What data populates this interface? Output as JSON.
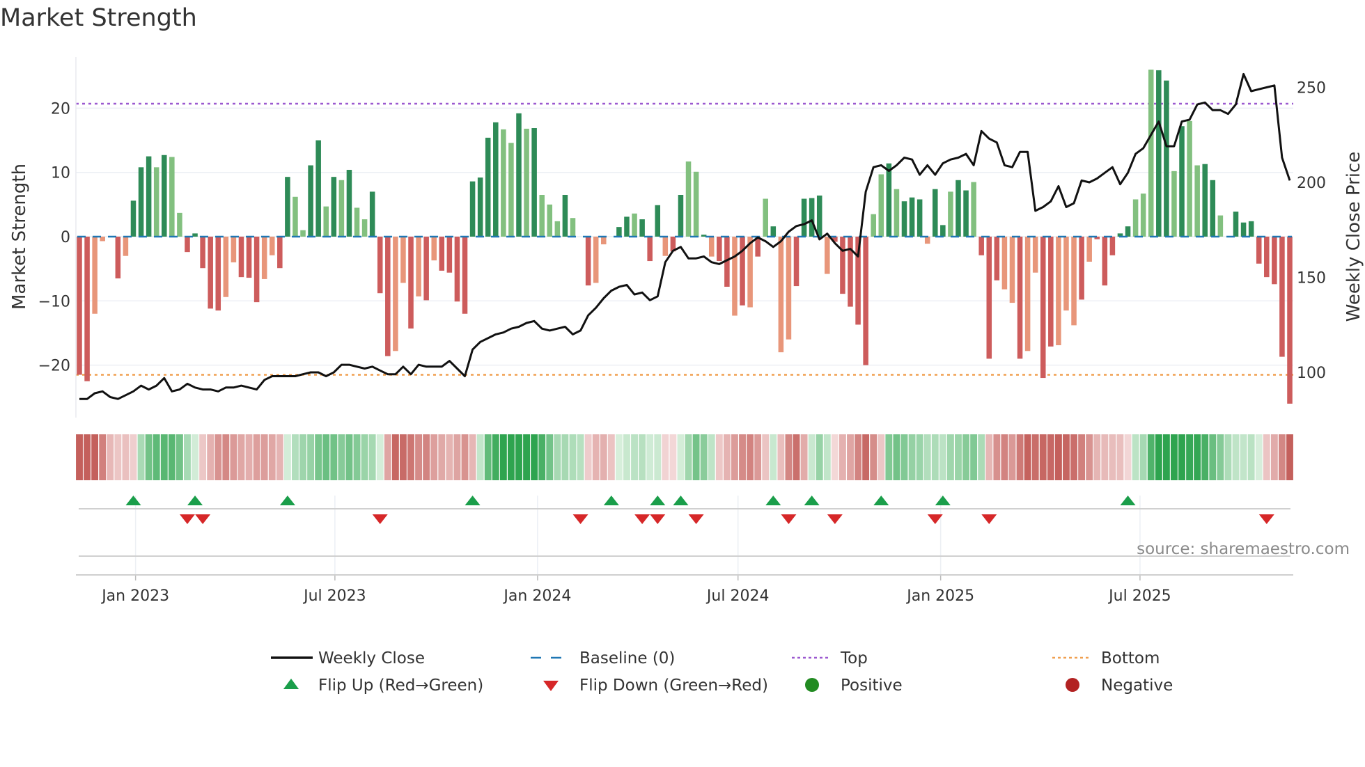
{
  "title": "Market Strength",
  "source": "source: sharemaestro.com",
  "chart_data": {
    "type": "bar",
    "title": "Market Strength",
    "ylabel": "Market Strength",
    "y2label": "Weekly Close Price",
    "ylim": [
      -28,
      28
    ],
    "y2lim": [
      72,
      277
    ],
    "yticks": [
      -20,
      -10,
      0,
      10,
      20
    ],
    "y2ticks": [
      100,
      150,
      200,
      250
    ],
    "grid": true,
    "start_date": "2022-11-11",
    "frequency": "weekly",
    "x_ticks": [
      {
        "date": "2023-01-01",
        "label": "Jan 2023"
      },
      {
        "date": "2023-07-01",
        "label": "Jul 2023"
      },
      {
        "date": "2024-01-01",
        "label": "Jan 2024"
      },
      {
        "date": "2024-07-01",
        "label": "Jul 2024"
      },
      {
        "date": "2025-01-01",
        "label": "Jan 2025"
      },
      {
        "date": "2025-07-01",
        "label": "Jul 2025"
      }
    ],
    "top_level": 20.7,
    "bottom_level": -21.5,
    "baseline": 0,
    "strength": [
      -21.5,
      -22.5,
      -12,
      -0.7,
      0,
      -6.5,
      -3,
      5.6,
      10.8,
      12.5,
      10.8,
      12.7,
      12.4,
      3.7,
      -2.4,
      0.5,
      -4.9,
      -11.2,
      -11.5,
      -9.4,
      -4,
      -6.3,
      -6.4,
      -10.2,
      -6.6,
      -2.9,
      -4.9,
      9.3,
      6.2,
      1.0,
      11.1,
      15.0,
      4.7,
      9.3,
      8.8,
      10.4,
      4.5,
      2.7,
      7.0,
      -8.8,
      -18.6,
      -17.8,
      -7.2,
      -14.3,
      -9.3,
      -9.9,
      -3.7,
      -5.3,
      -5.6,
      -10.1,
      -12.0,
      8.6,
      9.2,
      15.4,
      17.8,
      16.7,
      14.6,
      19.2,
      16.8,
      16.9,
      6.5,
      5.0,
      2.4,
      6.5,
      2.9,
      0,
      -7.6,
      -7.2,
      -1.2,
      0,
      1.5,
      3.1,
      3.6,
      2.7,
      -3.8,
      4.9,
      -3,
      -2.3,
      6.5,
      11.7,
      10.1,
      0.3,
      -3.1,
      -3.8,
      -7.8,
      -12.3,
      -10.7,
      -11,
      -3.1,
      5.9,
      1.6,
      -18,
      -16,
      -7.7,
      5.9,
      6.0,
      6.4,
      -5.8,
      -0.8,
      -8.9,
      -10.9,
      -13.7,
      -20,
      3.5,
      9.7,
      11.4,
      7.4,
      5.5,
      6.1,
      5.8,
      -1.1,
      7.4,
      1.8,
      7.0,
      8.8,
      7.2,
      8.5,
      -2.9,
      -19,
      -6.8,
      -8.2,
      -10.3,
      -19,
      -17.8,
      -5.6,
      -22,
      -17.1,
      -16.9,
      -11.5,
      -13.8,
      -9.8,
      -3.9,
      -0.4,
      -7.6,
      -2.9,
      0.5,
      1.6,
      5.8,
      6.7,
      26,
      25.9,
      24.3,
      10.2,
      17.2,
      18,
      11.1,
      11.3,
      8.8,
      3.3,
      0,
      3.9,
      2.2,
      2.4,
      -4.2,
      -6.3,
      -7.4,
      -18.7,
      -26
    ],
    "shade": "ddllddldddldlldddddlldddllddllddldldllddd lldldlddddddddlldldllldlddlldddldddlddlldlddldldldllddddldddddlldldddlddlddldddlldllddllldldddddlllddldllddldddddd",
    "weekly_close": [
      86,
      86,
      89,
      90,
      87,
      86,
      88,
      90,
      93,
      91,
      93,
      97,
      90,
      91,
      94,
      92,
      91,
      91,
      90,
      92,
      92,
      93,
      92,
      91,
      96,
      98,
      98,
      98,
      98,
      99,
      100,
      100,
      98,
      100,
      104,
      104,
      103,
      102,
      103,
      101,
      99,
      99,
      103,
      99,
      104,
      103,
      103,
      103,
      106,
      102,
      98,
      112,
      116,
      118,
      120,
      121,
      123,
      124,
      126,
      127,
      123,
      122,
      123,
      124,
      120,
      122,
      130,
      134,
      139,
      143,
      145,
      146,
      141,
      142,
      138,
      140,
      158,
      164,
      166,
      160,
      160,
      161,
      158,
      157,
      159,
      161,
      164,
      168,
      171,
      169,
      166,
      169,
      174,
      177,
      178,
      180,
      170,
      173,
      168,
      164,
      165,
      161,
      195,
      208,
      209,
      206,
      209,
      213,
      212,
      204,
      209,
      204,
      210,
      212,
      213,
      215,
      209,
      227,
      223,
      221,
      209,
      208,
      216,
      216,
      185,
      187,
      190,
      198,
      187,
      189,
      201,
      200,
      202,
      205,
      208,
      199,
      205,
      215,
      218,
      225,
      232,
      219,
      219,
      232,
      233,
      241,
      242,
      238,
      238,
      236,
      241,
      257,
      248,
      249,
      250,
      251,
      213,
      201
    ],
    "flip_up_weeks": [
      7,
      15,
      27,
      51,
      69,
      75,
      78,
      90,
      95,
      104,
      112,
      136
    ],
    "flip_down_weeks": [
      14,
      16,
      39,
      65,
      73,
      75,
      80,
      92,
      98,
      111,
      118,
      154
    ],
    "colors": {
      "strong_positive": "#2e8b57",
      "weak_positive": "#82c07f",
      "strong_negative": "#cd5c5c",
      "weak_negative": "#e8967a",
      "price": "#111111",
      "baseline": "#1f77b4",
      "top": "#9b59d0",
      "bottom": "#f0a050",
      "flip_up": "#1a9e4a",
      "flip_down": "#d62728",
      "positive": "#228b22",
      "negative": "#b22222"
    },
    "legend": {
      "placement": "bottom",
      "items": [
        {
          "key": "close",
          "label": "Weekly Close"
        },
        {
          "key": "baseline",
          "label": "Baseline (0)"
        },
        {
          "key": "top",
          "label": "Top"
        },
        {
          "key": "bottom",
          "label": "Bottom"
        },
        {
          "key": "flip_up",
          "label": "Flip Up (Red→Green)"
        },
        {
          "key": "flip_down",
          "label": "Flip Down (Green→Red)"
        },
        {
          "key": "positive",
          "label": "Positive"
        },
        {
          "key": "negative",
          "label": "Negative"
        }
      ]
    }
  }
}
